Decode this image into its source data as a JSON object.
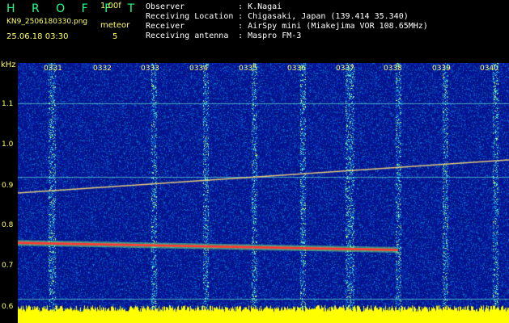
{
  "header": {
    "app_title": "H R O F F T",
    "version": "1.00f",
    "file_name": "KN9_2506180330.png",
    "meteor_label": "meteor",
    "meteor_count": "5",
    "datetime": "25.06.18 03:30",
    "info": [
      {
        "key": "Observer",
        "sep": ":",
        "value": "K.Nagai"
      },
      {
        "key": "Receiving Location",
        "sep": ":",
        "value": "Chigasaki, Japan (139.414 35.340)"
      },
      {
        "key": "Receiver",
        "sep": ":",
        "value": "AirSpy mini (Miakejima VOR 108.65MHz)"
      },
      {
        "key": "Receiving antenna",
        "sep": ":",
        "value": "Maspro FM-3"
      }
    ]
  },
  "axis": {
    "y_unit": "kHz",
    "y_ticks": [
      "1.1",
      "1.0",
      "0.9",
      "0.8",
      "0.7",
      "0.6"
    ],
    "time_ticks": [
      "0331",
      "0332",
      "0333",
      "0334",
      "0335",
      "0336",
      "0337",
      "0338",
      "0339",
      "0340"
    ]
  },
  "colors": {
    "background": "#000000",
    "spectrum_base": "#0a1f9e",
    "noise_floor": "#ffff00",
    "label_yellow": "#ffff66",
    "title_green": "#22ff88",
    "carrier_trace": "#ff4444"
  }
}
